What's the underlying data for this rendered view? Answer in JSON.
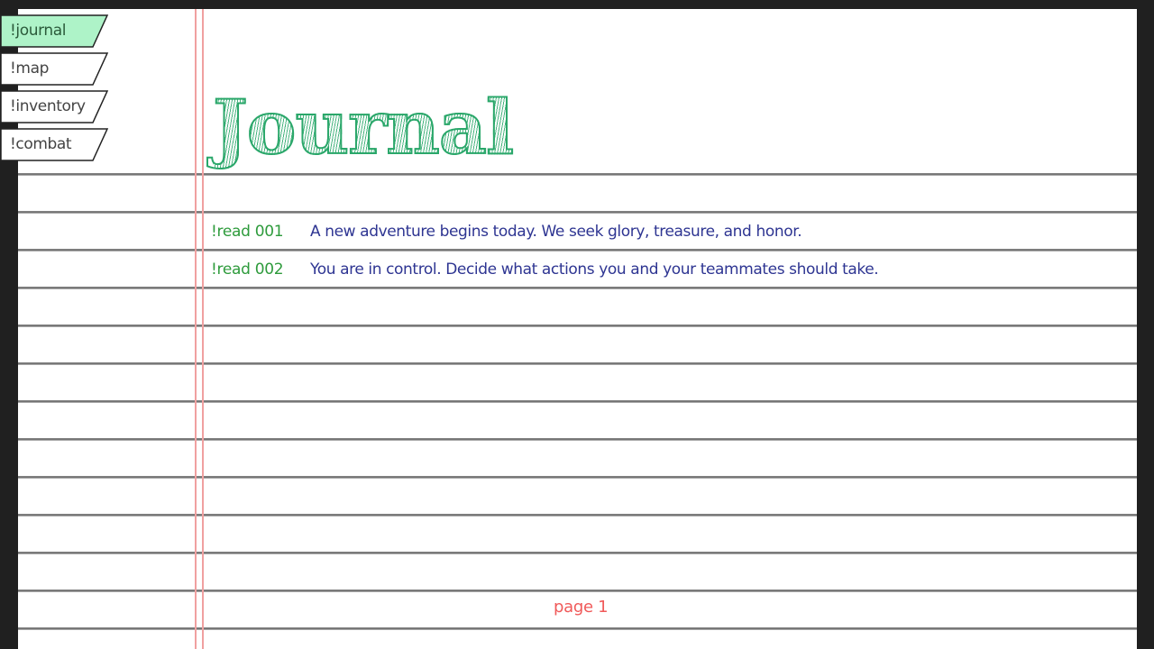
{
  "tabs": [
    {
      "label": "!journal",
      "active": true
    },
    {
      "label": "!map",
      "active": false
    },
    {
      "label": "!inventory",
      "active": false
    },
    {
      "label": "!combat",
      "active": false
    }
  ],
  "title": "Journal",
  "entries": [
    {
      "command": "!read 001",
      "text": "A new adventure begins today. We seek glory, treasure, and honor."
    },
    {
      "command": "!read 002",
      "text": "You are in control. Decide what actions you and your teammates should take."
    }
  ],
  "page_label": "page 1",
  "colors": {
    "active_tab": "#aef3c8",
    "title_green": "#2aa76a",
    "command_green": "#2e9b3c",
    "entry_blue": "#2e3592",
    "page_red": "#f05a5a",
    "margin_line": "#f0a0a0"
  }
}
